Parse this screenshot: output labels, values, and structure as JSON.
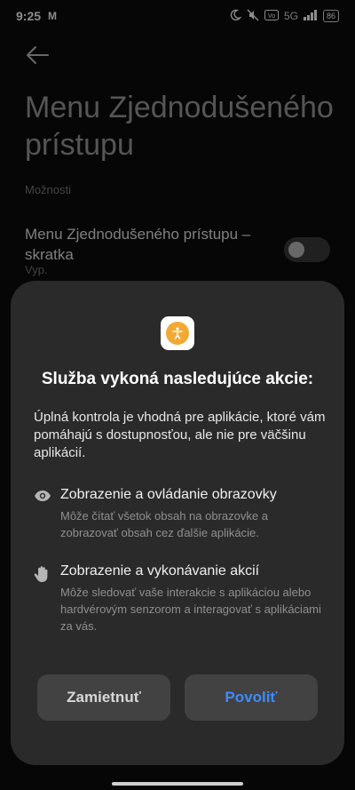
{
  "status_bar": {
    "time": "9:25",
    "mail_glyph": "M",
    "network": "5G",
    "battery": "86",
    "icons": [
      "moon-icon",
      "mute-icon",
      "volte-icon",
      "signal-icon",
      "battery-icon"
    ]
  },
  "page": {
    "title": "Menu Zjednodušeného prístupu",
    "section_label": "Možnosti",
    "setting": {
      "title": "Menu Zjednodušeného prístupu – skratka",
      "subtitle": "Vyp.",
      "toggle_on": false
    }
  },
  "dialog": {
    "title": "Služba vykoná nasledujúce akcie:",
    "body": "Úplná kontrola je vhodná pre aplikácie, ktoré vám pomáhajú s dostupnosťou, ale nie pre väčšinu aplikácií.",
    "permissions": [
      {
        "icon": "eye-icon",
        "title": "Zobrazenie a ovládanie obrazovky",
        "description": "Môže čítať všetok obsah na obrazovke a zobrazovať obsah cez ďalšie aplikácie."
      },
      {
        "icon": "hand-icon",
        "title": "Zobrazenie a vykonávanie akcií",
        "description": "Môže sledovať vaše interakcie s aplikáciou alebo hardvérovým senzorom a interagovať s aplikáciami za vás."
      }
    ],
    "deny_label": "Zamietnuť",
    "allow_label": "Povoliť"
  },
  "colors": {
    "allow_accent": "#3d8bff",
    "app_icon": "#f2a934",
    "dialog_bg": "#2a2a2a"
  }
}
